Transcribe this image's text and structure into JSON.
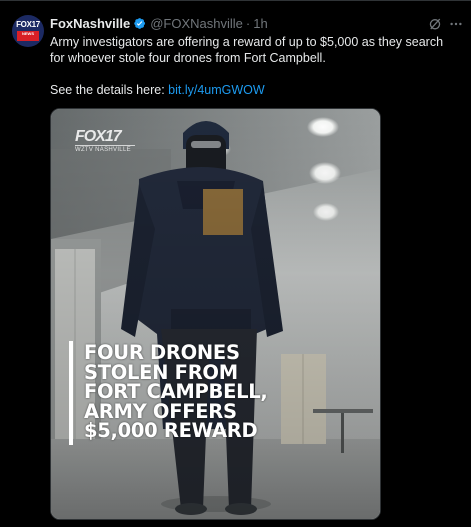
{
  "tweet": {
    "display_name": "FoxNashville",
    "handle": "@FOXNashville",
    "separator": "·",
    "time": "1h",
    "body_line1": "Army investigators are offering a reward of up to $5,000 as they search for whoever stole four drones from Fort Campbell.",
    "body_line2_prefix": "See the details here: ",
    "link_text": "bit.ly/4umGWOW"
  },
  "avatar": {
    "logo_text": "FOX17",
    "logo_subtext": "NEWS"
  },
  "media": {
    "watermark_main": "FOX17",
    "watermark_sub": "WZTV NASHVILLE",
    "headline_lines": [
      "FOUR DRONES",
      "STOLEN FROM",
      "FORT CAMPBELL,",
      "ARMY OFFERS",
      "$5,000 REWARD"
    ]
  },
  "icons": {
    "verified": "verified-badge-icon",
    "grok": "grok-icon",
    "more": "more-options-icon"
  },
  "colors": {
    "background": "#000000",
    "text": "#e7e9ea",
    "muted": "#71767b",
    "link": "#1d9bf0",
    "verified": "#1d9bf0"
  }
}
